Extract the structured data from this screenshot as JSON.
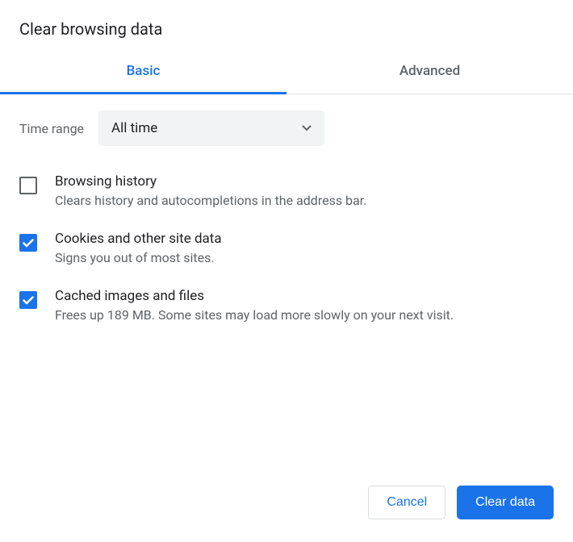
{
  "dialog": {
    "title": "Clear browsing data"
  },
  "tabs": {
    "basic": "Basic",
    "advanced": "Advanced"
  },
  "timerange": {
    "label": "Time range",
    "value": "All time"
  },
  "options": [
    {
      "checked": false,
      "title": "Browsing history",
      "desc": "Clears history and autocompletions in the address bar."
    },
    {
      "checked": true,
      "title": "Cookies and other site data",
      "desc": "Signs you out of most sites."
    },
    {
      "checked": true,
      "title": "Cached images and files",
      "desc": "Frees up 189 MB. Some sites may load more slowly on your next visit."
    }
  ],
  "buttons": {
    "cancel": "Cancel",
    "clear": "Clear data"
  }
}
